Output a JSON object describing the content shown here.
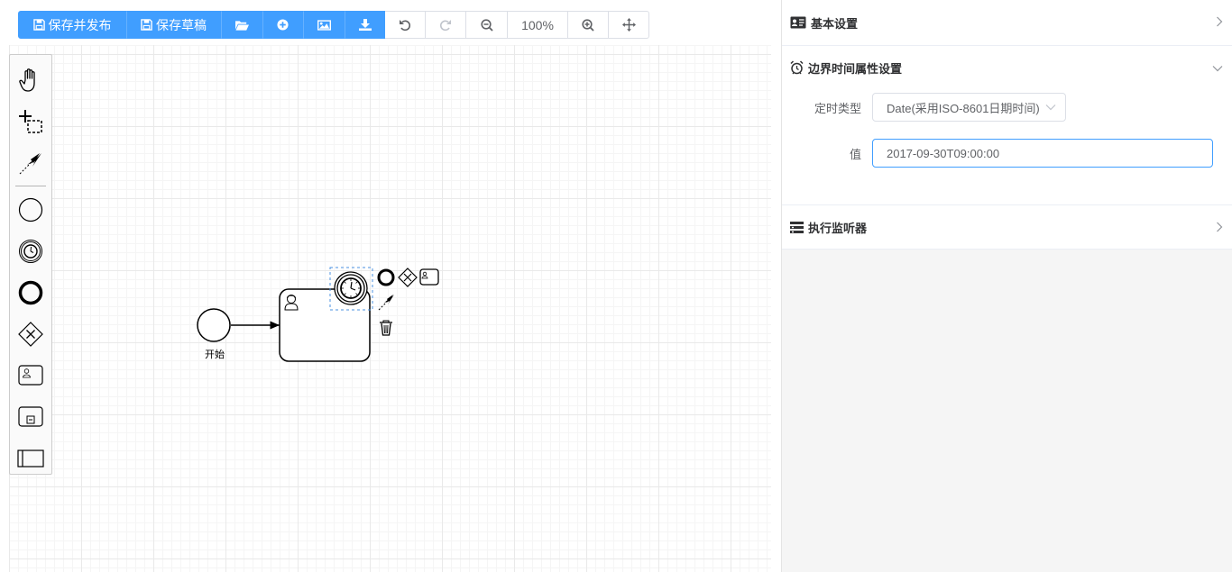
{
  "toolbar": {
    "save_publish_label": "保存并发布",
    "save_draft_label": "保存草稿",
    "zoom_level": "100%"
  },
  "diagram": {
    "start_event_label": "开始"
  },
  "panel": {
    "basic_settings_title": "基本设置",
    "boundary_timer_title": "边界时间属性设置",
    "timer_type_label": "定时类型",
    "timer_type_value": "Date(采用ISO-8601日期时间)",
    "value_label": "值",
    "value_input": "2017-09-30T09:00:00",
    "listener_title": "执行监听器"
  },
  "colors": {
    "primary": "#409eff",
    "selection": "#4a90e2"
  }
}
